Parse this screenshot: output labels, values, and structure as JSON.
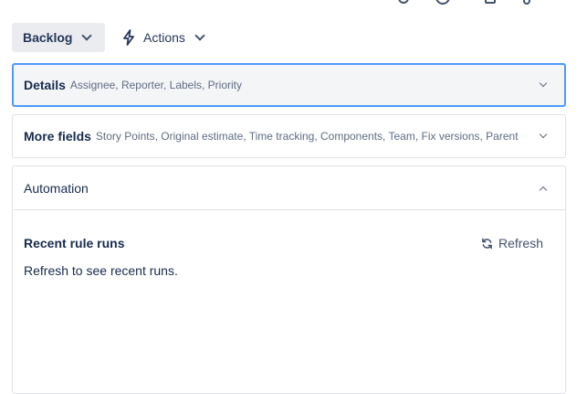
{
  "toolbar": {
    "status_label": "Backlog",
    "actions_label": "Actions"
  },
  "top_icons": [
    "search-icon",
    "clock-icon",
    "copy-icon",
    "link-icon"
  ],
  "details": {
    "title": "Details",
    "summary": "Assignee, Reporter, Labels, Priority"
  },
  "more_fields": {
    "title": "More fields",
    "summary": "Story Points, Original estimate, Time tracking, Components, Team, Fix versions, Parent"
  },
  "automation": {
    "title": "Automation",
    "recent_runs_title": "Recent rule runs",
    "refresh_label": "Refresh",
    "empty_message": "Refresh to see recent runs."
  },
  "colors": {
    "focus_border": "#4c9aff",
    "button_bg": "#ebecf0",
    "text_primary": "#172b4d",
    "text_subtle": "#5e6c84"
  }
}
